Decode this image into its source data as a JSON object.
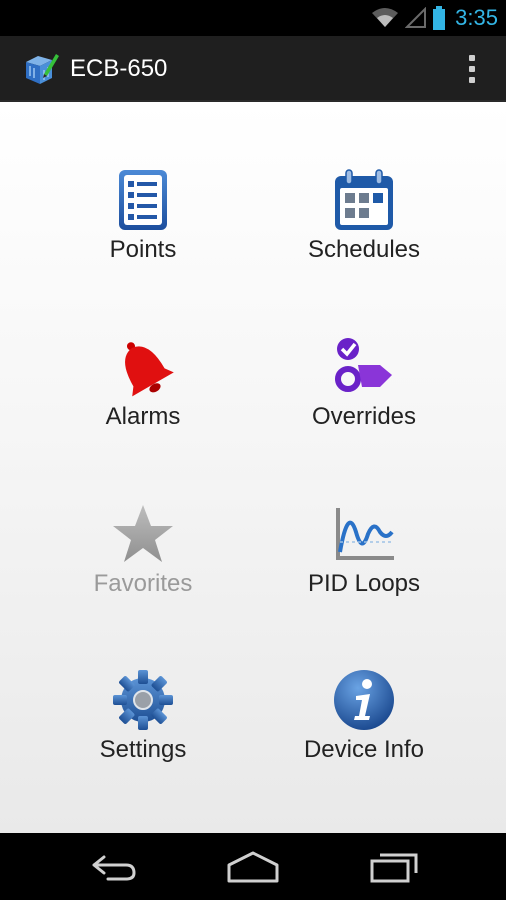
{
  "status": {
    "time": "3:35"
  },
  "app": {
    "title": "ECB-650"
  },
  "menu": [
    {
      "label": "Points",
      "icon": "points-list-icon"
    },
    {
      "label": "Schedules",
      "icon": "calendar-icon"
    },
    {
      "label": "Alarms",
      "icon": "alarm-bell-icon"
    },
    {
      "label": "Overrides",
      "icon": "override-icon"
    },
    {
      "label": "Favorites",
      "icon": "star-icon",
      "enabled": false
    },
    {
      "label": "PID Loops",
      "icon": "pid-chart-icon"
    },
    {
      "label": "Settings",
      "icon": "gear-icon"
    },
    {
      "label": "Device Info",
      "icon": "info-icon"
    }
  ],
  "colors": {
    "accent": "#33b5e5",
    "actionbar": "#1f1f1f",
    "label": "#222222",
    "disabled": "#9a9a9a"
  }
}
